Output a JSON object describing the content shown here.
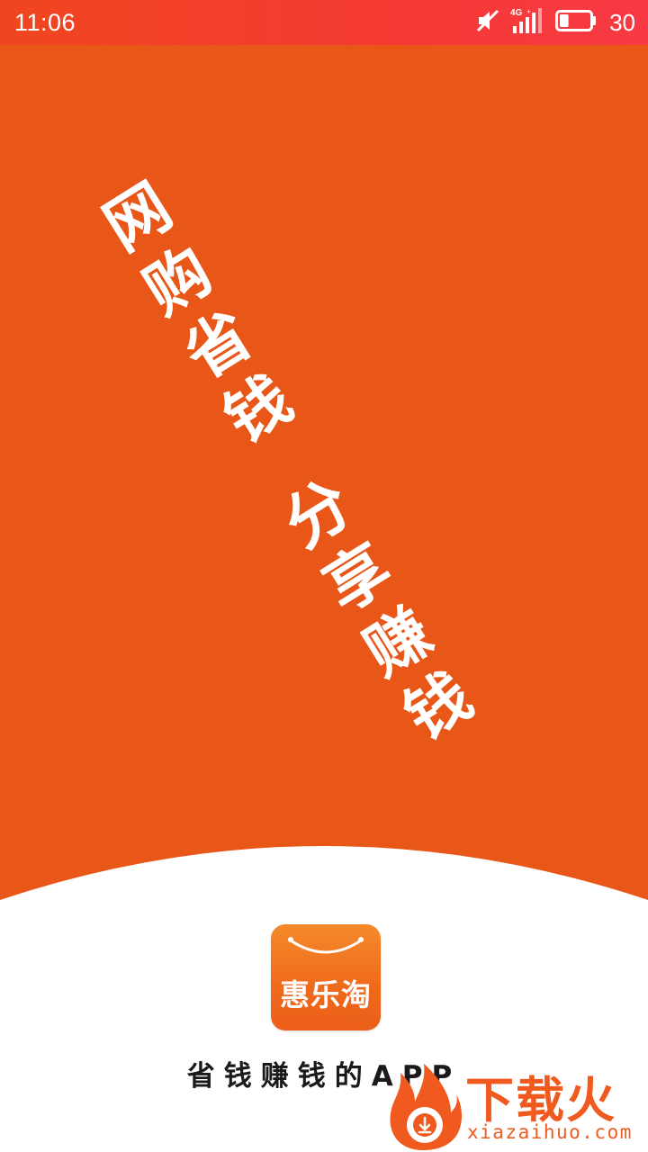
{
  "status_bar": {
    "time": "11:06",
    "network_label": "4G",
    "battery_level": "30",
    "icons": [
      "mute-icon",
      "signal-icon",
      "battery-icon"
    ],
    "background_color": "#f53a34"
  },
  "splash": {
    "background_color": "#e85618",
    "slogan_line_1": "网购省钱",
    "slogan_line_2": "分享赚钱"
  },
  "app": {
    "logo_text": "惠乐淘",
    "tagline": "省钱赚钱的APP",
    "logo_color": "#ef6a1c"
  },
  "watermark": {
    "title": "下载火",
    "domain": "xiazaihuo.com",
    "icon": "flame-download-icon",
    "color": "#f05a1e"
  }
}
